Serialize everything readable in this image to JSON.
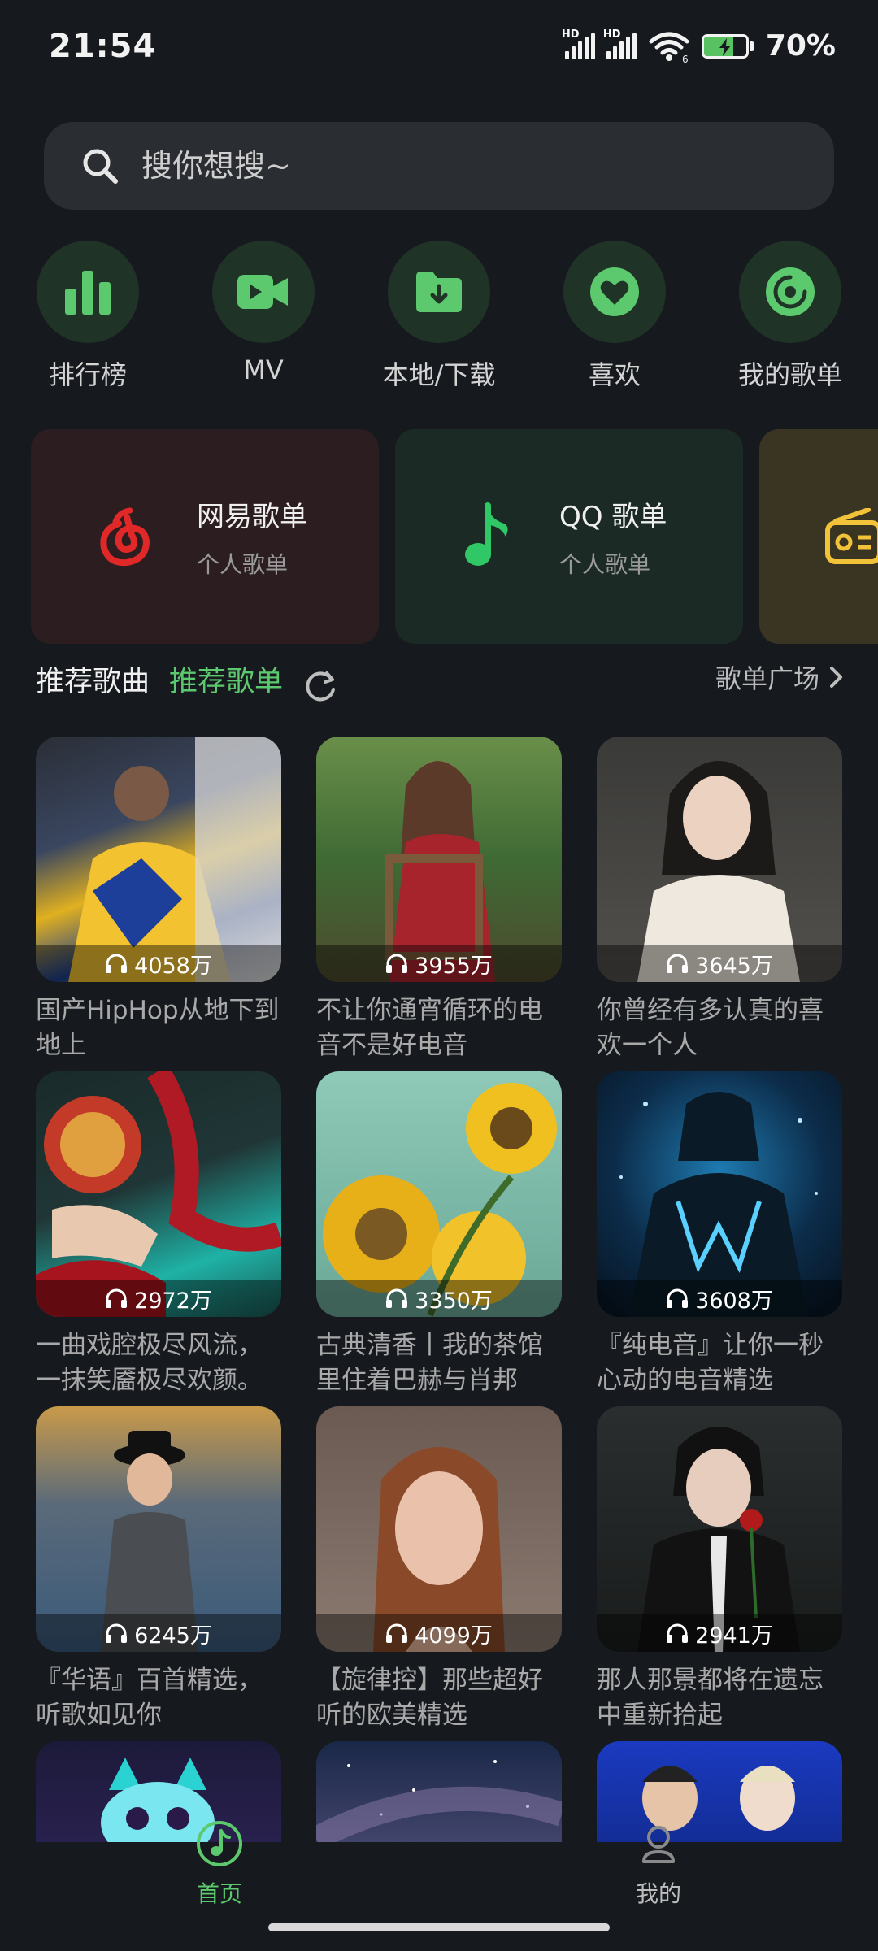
{
  "status": {
    "time": "21:54",
    "signal1": "HD",
    "signal2": "HD",
    "wifi_badge": "6",
    "battery_pct": "70%",
    "battery_level": 0.7
  },
  "search": {
    "placeholder": "搜你想搜~"
  },
  "quick": [
    {
      "label": "排行榜",
      "icon": "bar-chart-icon"
    },
    {
      "label": "MV",
      "icon": "video-icon"
    },
    {
      "label": "本地/下载",
      "icon": "folder-download-icon"
    },
    {
      "label": "喜欢",
      "icon": "heart-icon"
    },
    {
      "label": "我的歌单",
      "icon": "disc-icon"
    }
  ],
  "sources": [
    {
      "title": "网易歌单",
      "subtitle": "个人歌单",
      "icon": "netease-logo-icon",
      "bg": "#2b1d20",
      "accent": "#e02828"
    },
    {
      "title": "QQ 歌单",
      "subtitle": "个人歌单",
      "icon": "music-note-icon",
      "bg": "#1b2a24",
      "accent": "#30c866"
    },
    {
      "title": "",
      "subtitle": "",
      "icon": "radio-icon",
      "bg": "#3a3422",
      "accent": "#f2c239"
    }
  ],
  "section": {
    "tab_songs": "推荐歌曲",
    "tab_playlists": "推荐歌单",
    "plaza": "歌单广场"
  },
  "playlists": [
    {
      "count": "4058万",
      "title": "国产HipHop从地下到地上"
    },
    {
      "count": "3955万",
      "title": "不让你通宵循环的电音不是好电音"
    },
    {
      "count": "3645万",
      "title": "你曾经有多认真的喜欢一个人"
    },
    {
      "count": "2972万",
      "title": "一曲戏腔极尽风流，一抹笑靥极尽欢颜。"
    },
    {
      "count": "3350万",
      "title": "古典清香丨我的茶馆里住着巴赫与肖邦"
    },
    {
      "count": "3608万",
      "title": "『纯电音』让你一秒心动的电音精选"
    },
    {
      "count": "6245万",
      "title": "『华语』百首精选，听歌如见你"
    },
    {
      "count": "4099万",
      "title": "【旋律控】那些超好听的欧美精选"
    },
    {
      "count": "2941万",
      "title": "那人那景都将在遗忘中重新拾起"
    },
    {
      "count": "",
      "title": ""
    },
    {
      "count": "",
      "title": ""
    },
    {
      "count": "",
      "title": ""
    }
  ],
  "nav": {
    "home": "首页",
    "mine": "我的"
  },
  "colors": {
    "accent": "#5cc96e",
    "bg": "#16191e"
  }
}
